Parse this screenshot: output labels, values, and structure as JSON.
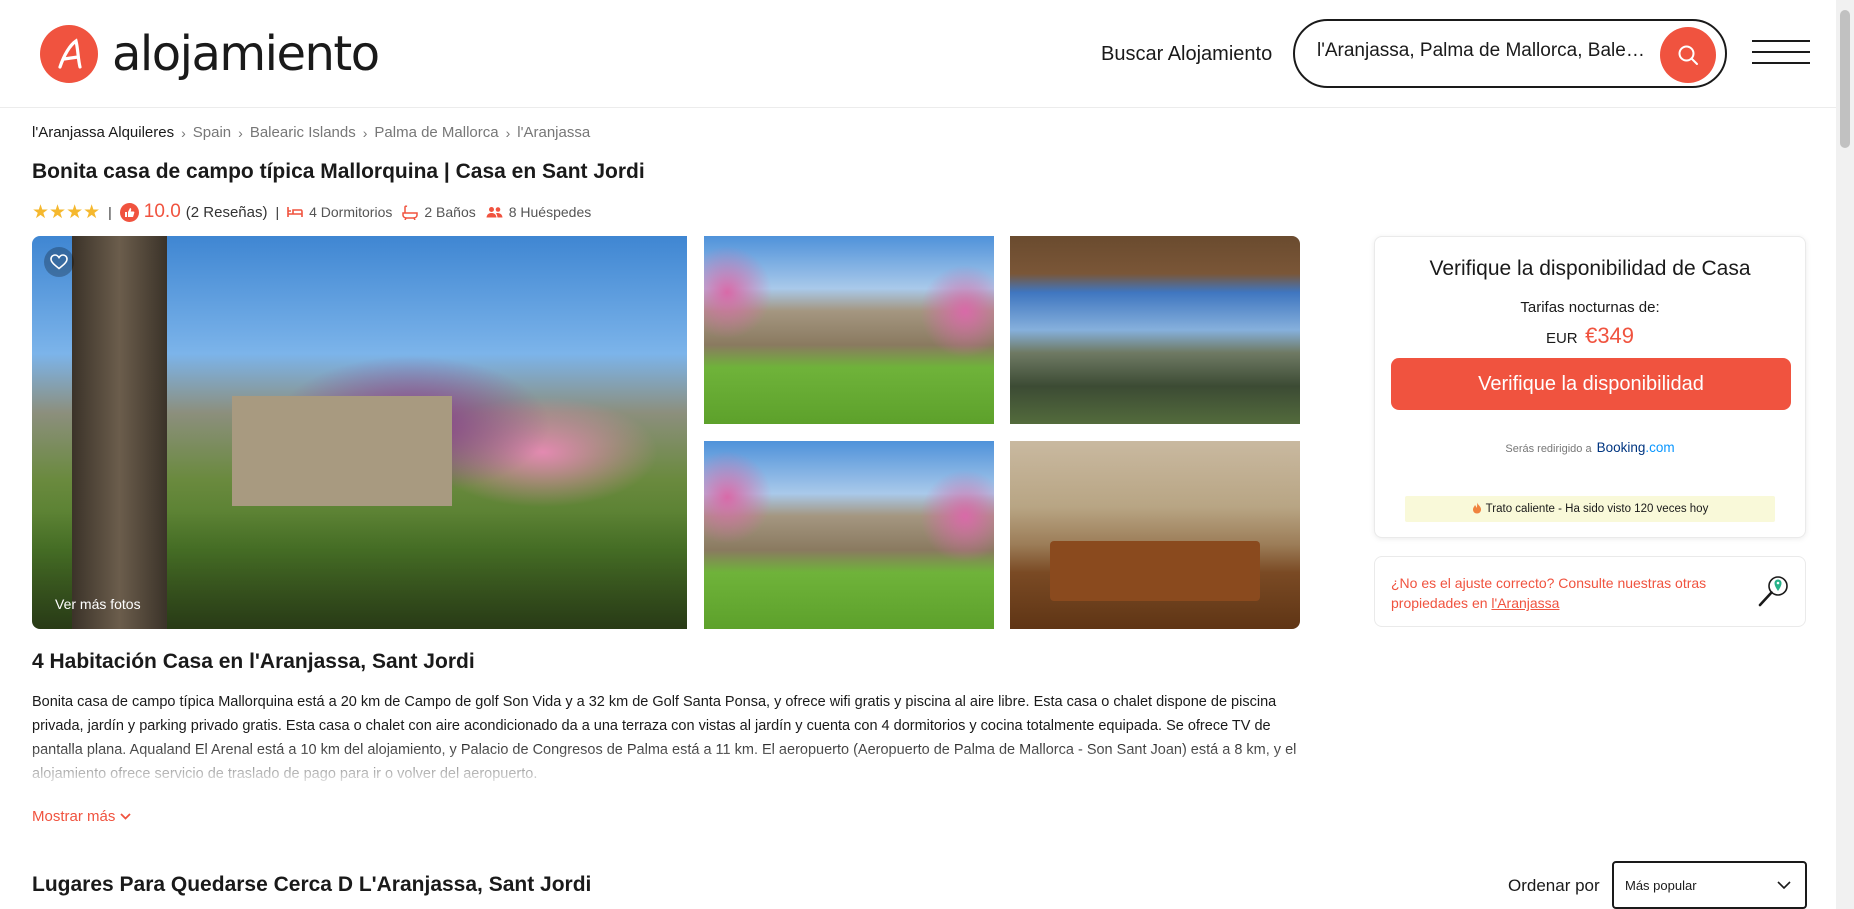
{
  "header": {
    "logo_text": "alojamiento",
    "nav_link": "Buscar Alojamiento",
    "search_value": "l'Aranjassa, Palma de Mallorca, Balea...",
    "accent_color": "#f0533f"
  },
  "breadcrumb": [
    "l'Aranjassa Alquileres",
    "Spain",
    "Balearic Islands",
    "Palma de Mallorca",
    "l'Aranjassa"
  ],
  "listing": {
    "title": "Bonita casa de campo típica Mallorquina | Casa en Sant Jordi",
    "stars": "★★★★",
    "star_count": 4,
    "score": "10.0",
    "reviews": "(2 Reseñas)",
    "bedrooms": "4 Dormitorios",
    "bathrooms": "2 Baños",
    "guests": "8 Huéspedes"
  },
  "gallery": {
    "more_photos": "Ver más fotos"
  },
  "description": {
    "heading": "4 Habitación Casa en l'Aranjassa, Sant Jordi",
    "text": "Bonita casa de campo típica Mallorquina está a 20 km de Campo de golf Son Vida y a 32 km de Golf Santa Ponsa, y ofrece wifi gratis y piscina al aire libre. Esta casa o chalet dispone de piscina privada, jardín y parking privado gratis. Esta casa o chalet con aire acondicionado da a una terraza con vistas al jardín y cuenta con 4 dormitorios y cocina totalmente equipada. Se ofrece TV de pantalla plana. Aqualand El Arenal está a 10 km del alojamiento, y Palacio de Congresos de Palma está a 11 km. El aeropuerto (Aeropuerto de Palma de Mallorca - Son Sant Joan) está a 8 km, y el alojamiento ofrece servicio de traslado de pago para ir o volver del aeropuerto.",
    "show_more": "Mostrar más"
  },
  "booking_card": {
    "title": "Verifique la disponibilidad de Casa",
    "rates_label": "Tarifas nocturnas de:",
    "currency": "EUR",
    "price": "€349",
    "button": "Verifique la disponibilidad",
    "redirect": "Serás redirigido a",
    "booking_brand": "Booking",
    "booking_tld": ".com",
    "hot_deal": "Trato caliente - Ha sido visto 120 veces hoy"
  },
  "alt_card": {
    "text": "¿No es el ajuste correcto? Consulte nuestras otras propiedades en",
    "link": "l'Aranjassa"
  },
  "nearby": {
    "heading": "Lugares Para Quedarse Cerca D L'Aranjassa, Sant Jordi",
    "order_label": "Ordenar por",
    "order_value": "Más popular"
  }
}
